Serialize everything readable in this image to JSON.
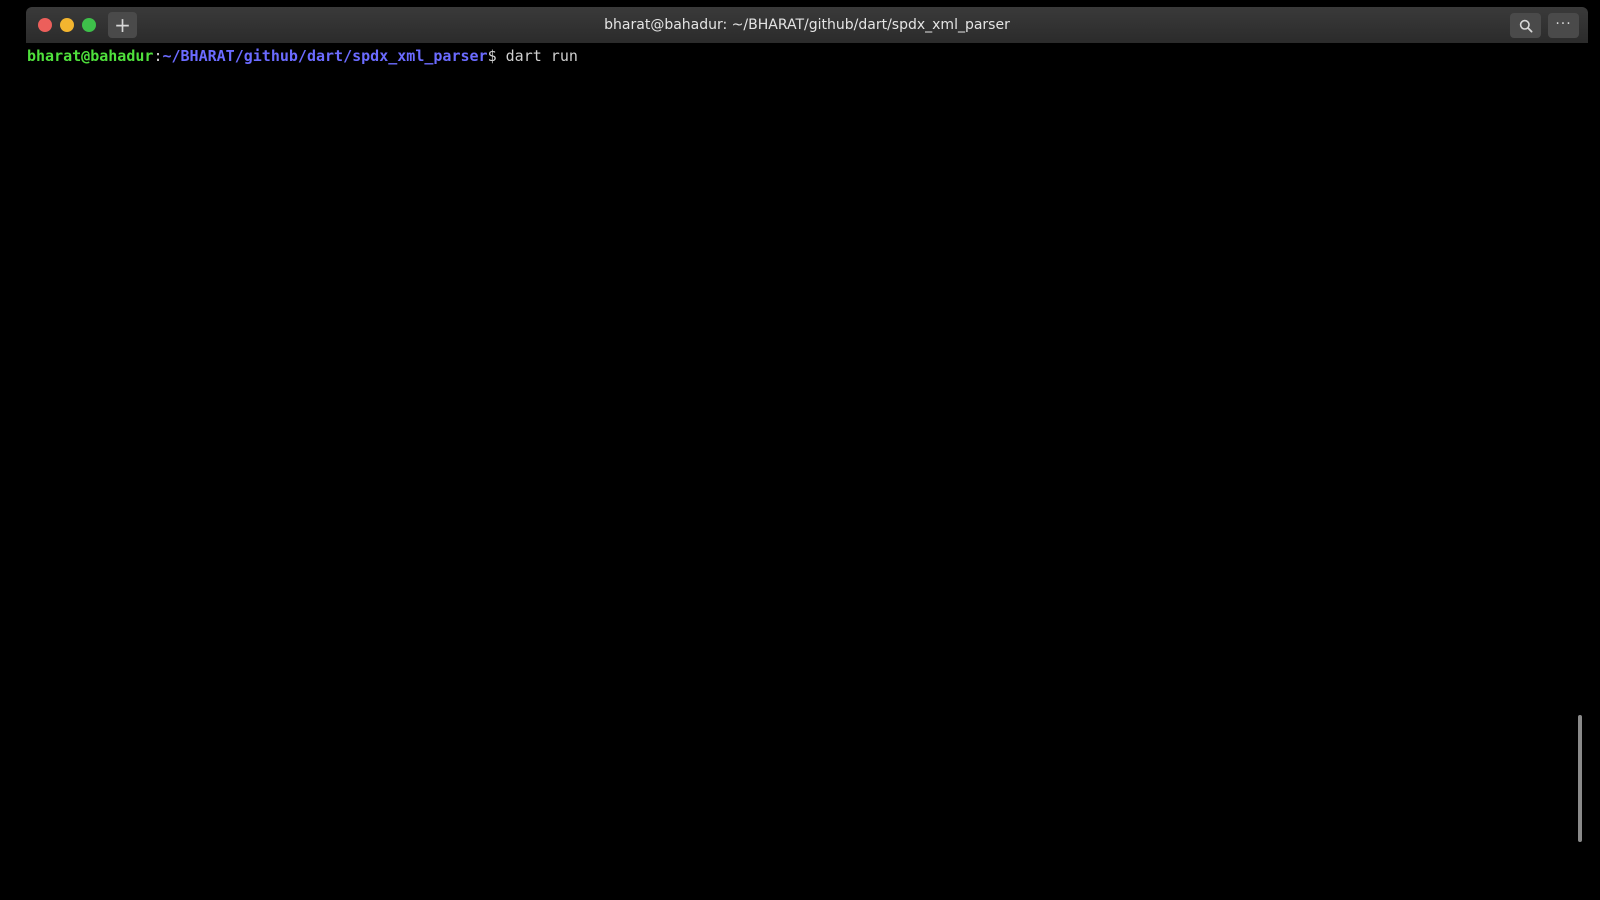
{
  "window": {
    "title": "bharat@bahadur: ~/BHARAT/github/dart/spdx_xml_parser",
    "new_tab_symbol": "+",
    "menu_symbol": "···",
    "icons": {
      "close": "close-circle",
      "minimize": "minimize-circle",
      "maximize": "maximize-circle",
      "new_tab": "plus-icon",
      "search": "search-icon",
      "menu": "more-icon"
    },
    "colors": {
      "close": "#ec5f5b",
      "minimize": "#f3b52f",
      "maximize": "#3ec04a"
    }
  },
  "terminal": {
    "prompt": {
      "user_host": "bharat@bahadur",
      "separator": ":",
      "path": "~/BHARAT/github/dart/spdx_xml_parser",
      "symbol": "$",
      "command": " dart run"
    },
    "colors": {
      "user_host": "#4fe03c",
      "path": "#6b6bff",
      "text": "#d0d0d0",
      "background": "#000000"
    }
  }
}
